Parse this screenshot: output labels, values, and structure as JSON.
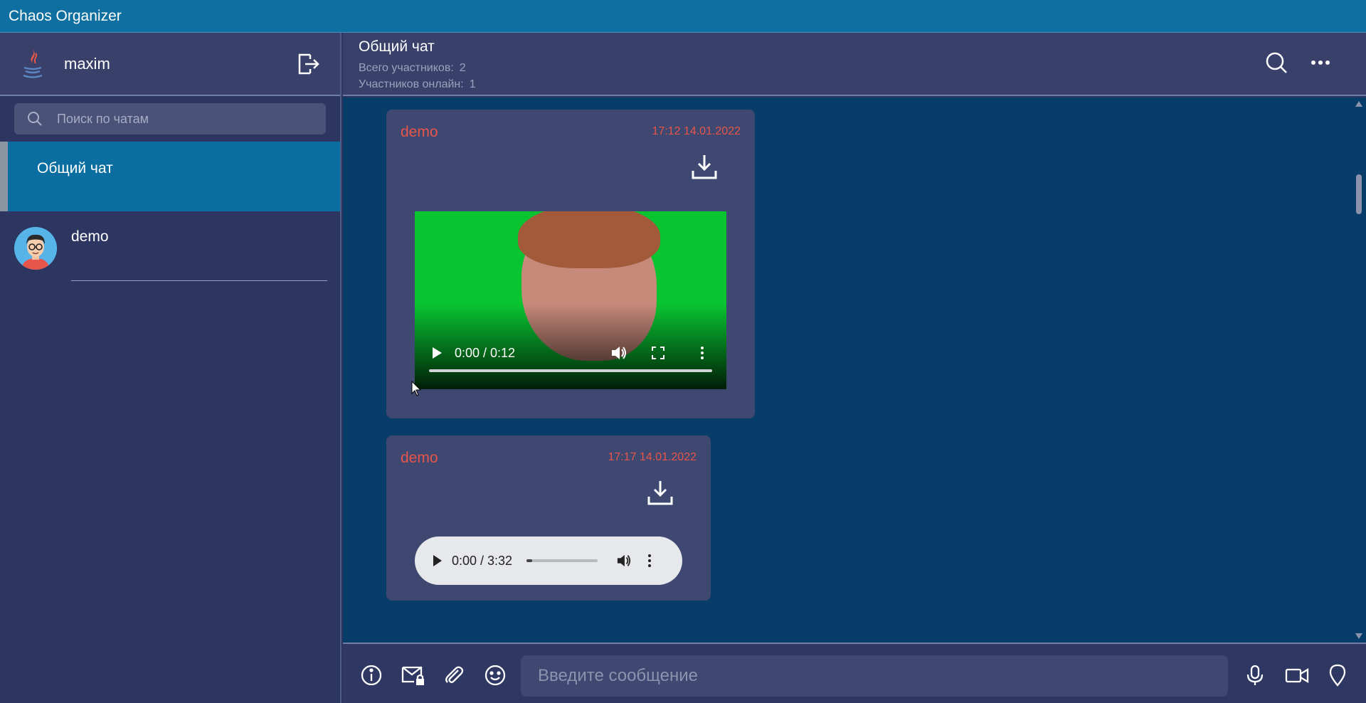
{
  "app": {
    "title": "Chaos Organizer"
  },
  "profile": {
    "username": "maxim"
  },
  "search": {
    "placeholder": "Поиск по чатам"
  },
  "chats": [
    {
      "name": "Общий чат",
      "active": true
    },
    {
      "name": "demo",
      "active": false
    }
  ],
  "chat_header": {
    "title": "Общий чат",
    "total_label": "Всего участников:",
    "total_value": "2",
    "online_label": "Участников онлайн:",
    "online_value": "1"
  },
  "messages": [
    {
      "author": "demo",
      "time": "17:12 14.01.2022",
      "media": {
        "type": "video",
        "time_display": "0:00 / 0:12"
      }
    },
    {
      "author": "demo",
      "time": "17:17 14.01.2022",
      "media": {
        "type": "audio",
        "time_display": "0:00 / 3:32"
      }
    }
  ],
  "composer": {
    "placeholder": "Введите сообщение"
  },
  "colors": {
    "topbar": "#0f6fa0",
    "sidebar": "#2d3561",
    "messages_bg": "#083d6a",
    "bubble": "#3e4870",
    "author": "#e8554a",
    "active_chat": "#0b6ea1"
  },
  "icons": [
    "java-logo-icon",
    "logout-icon",
    "search-icon",
    "more-icon",
    "download-icon",
    "play-icon",
    "volume-icon",
    "fullscreen-icon",
    "info-icon",
    "mail-lock-icon",
    "paperclip-icon",
    "emoji-icon",
    "microphone-icon",
    "video-camera-icon",
    "location-icon"
  ]
}
